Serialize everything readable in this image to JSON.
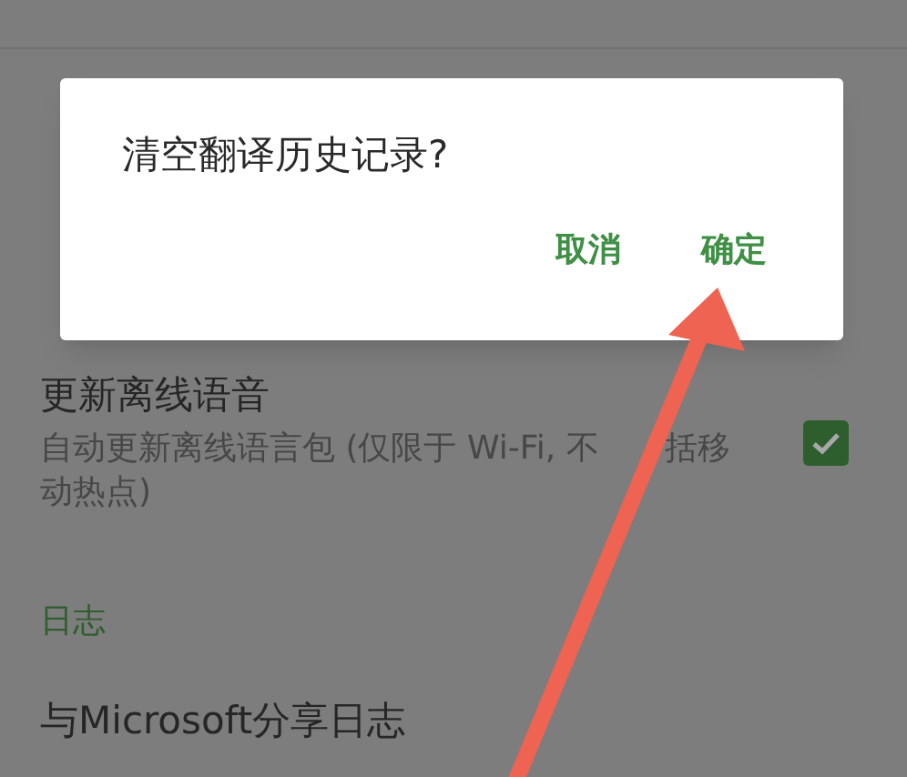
{
  "settings": [
    {
      "kind": "checkbox_item",
      "title": "更新离线语音",
      "subtitle_lines": [
        [
          "自动更新离线语言包 (仅限于 Wi-Fi, 不",
          "括移"
        ],
        [
          "动热点)"
        ]
      ],
      "checked": true
    },
    {
      "kind": "header",
      "title": "日志"
    },
    {
      "kind": "item",
      "title": "与Microsoft分享日志"
    }
  ],
  "dialog": {
    "title": "清空翻译历史记录?",
    "buttons": [
      {
        "label": "取消"
      },
      {
        "label": "确定"
      }
    ]
  }
}
